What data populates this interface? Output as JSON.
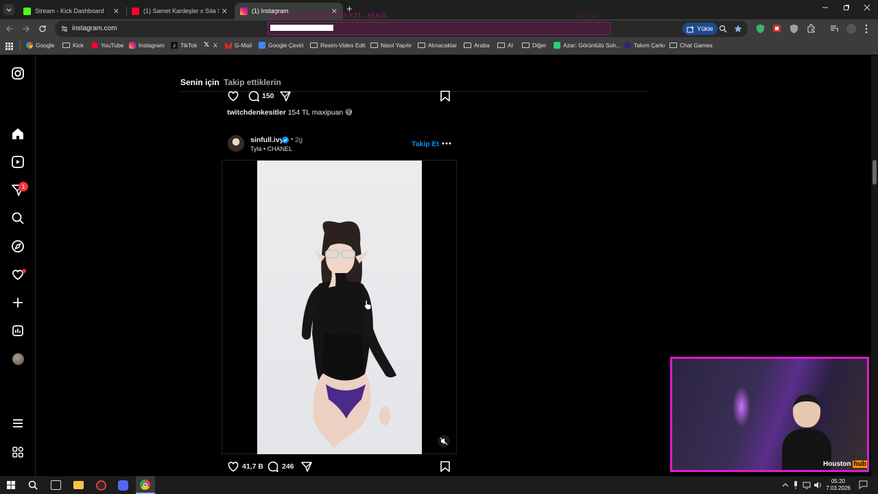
{
  "browser": {
    "tabs": [
      {
        "title": "Stream - Kick Dashboard",
        "active": false
      },
      {
        "title": "(1) Samet Kardeşler x Sıla Şahin",
        "active": false
      },
      {
        "title": "(1) Instagram",
        "active": true
      }
    ],
    "url": "instagram.com",
    "upload_label": "Yükle",
    "overlay_banner": "SİSTEM UPGRADE'E BENZİ... ŞEKİL",
    "overlay_counter": "10 / 110",
    "bookmarks": [
      "Google",
      "Kick",
      "YouTube",
      "Instagram",
      "TikTok",
      "X",
      "G-Mail",
      "Google Çeviri",
      "Resim-Video Edit",
      "Nasıl Yapılır",
      "Alınacaklar",
      "Araba",
      "AI",
      "Diğer",
      "Azar: Görüntülü Soh...",
      "Takım Çarkı",
      "Chat Games"
    ]
  },
  "instagram": {
    "notification_badge": "1",
    "feed_tabs": {
      "for_you": "Senin için",
      "following": "Takip ettiklerin"
    },
    "prev_post": {
      "comments": "150",
      "caption_user": "twitchdenkesitler",
      "caption_text": "154 TL maxipuan 😅"
    },
    "post": {
      "username": "sinfull.ivy",
      "age": "2g",
      "audio_line": "Tyla • CHANEL",
      "follow_label": "Takip Et",
      "likes": "41,7 B",
      "comments": "246"
    }
  },
  "stream_overlay": {
    "brand_a": "Houston",
    "brand_b": "hub"
  },
  "taskbar": {
    "time": "05:20",
    "date": "7.03.2026"
  },
  "colors": {
    "accent": "#0095f6",
    "badge": "#ff3040",
    "cam_border": "#e01bd0",
    "cam_glow": "#38c0ff"
  }
}
